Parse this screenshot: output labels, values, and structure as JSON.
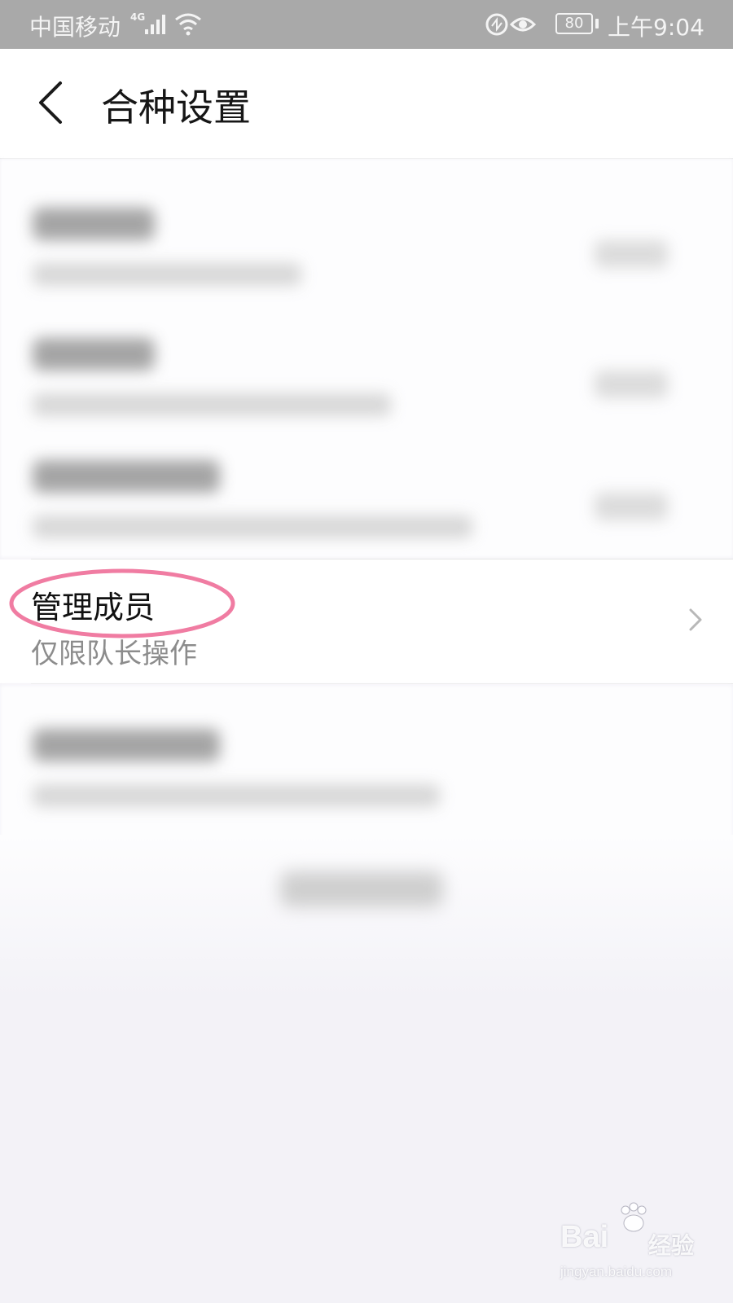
{
  "status_bar": {
    "carrier": "中国移动",
    "network": "4G",
    "battery": "80",
    "time": "上午9:04"
  },
  "header": {
    "title": "合种设置"
  },
  "manage_members": {
    "label": "管理成员",
    "subtitle": "仅限队长操作"
  },
  "watermark": {
    "brand": "Bai",
    "brand_cn": "经验",
    "url": "jingyan.baidu.com"
  },
  "colors": {
    "highlight_ellipse": "#f07ca2",
    "status_bar_bg": "#a9a9a9",
    "page_bg": "#f3f2f7"
  }
}
